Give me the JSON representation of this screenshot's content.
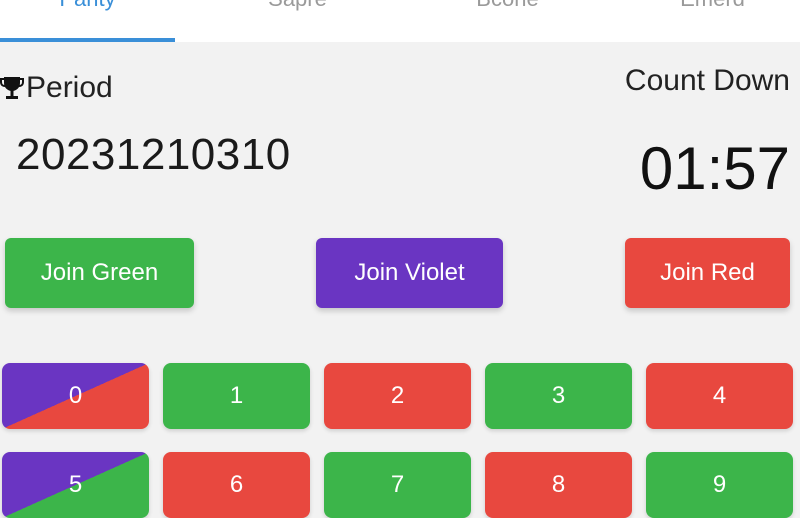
{
  "tabs": [
    {
      "label": "Parity",
      "active": true
    },
    {
      "label": "Sapre",
      "active": false
    },
    {
      "label": "Bcone",
      "active": false
    },
    {
      "label": "Emerd",
      "active": false
    }
  ],
  "period": {
    "label": "Period",
    "number": "20231210310",
    "icon": "trophy-icon"
  },
  "countdown": {
    "label": "Count Down",
    "value": "01:57"
  },
  "join_buttons": [
    {
      "label": "Join Green",
      "color": "#3cb54a"
    },
    {
      "label": "Join Violet",
      "color": "#6a35c2"
    },
    {
      "label": "Join Red",
      "color": "#e8483f"
    }
  ],
  "number_buttons": [
    {
      "label": "0",
      "style": "violet-red"
    },
    {
      "label": "1",
      "style": "green"
    },
    {
      "label": "2",
      "style": "red"
    },
    {
      "label": "3",
      "style": "green"
    },
    {
      "label": "4",
      "style": "red"
    },
    {
      "label": "5",
      "style": "violet-green"
    },
    {
      "label": "6",
      "style": "red"
    },
    {
      "label": "7",
      "style": "green"
    },
    {
      "label": "8",
      "style": "red"
    },
    {
      "label": "9",
      "style": "green"
    }
  ],
  "colors": {
    "green": "#3cb54a",
    "red": "#e8483f",
    "violet": "#6a35c2",
    "accent": "#3a8fd8"
  }
}
